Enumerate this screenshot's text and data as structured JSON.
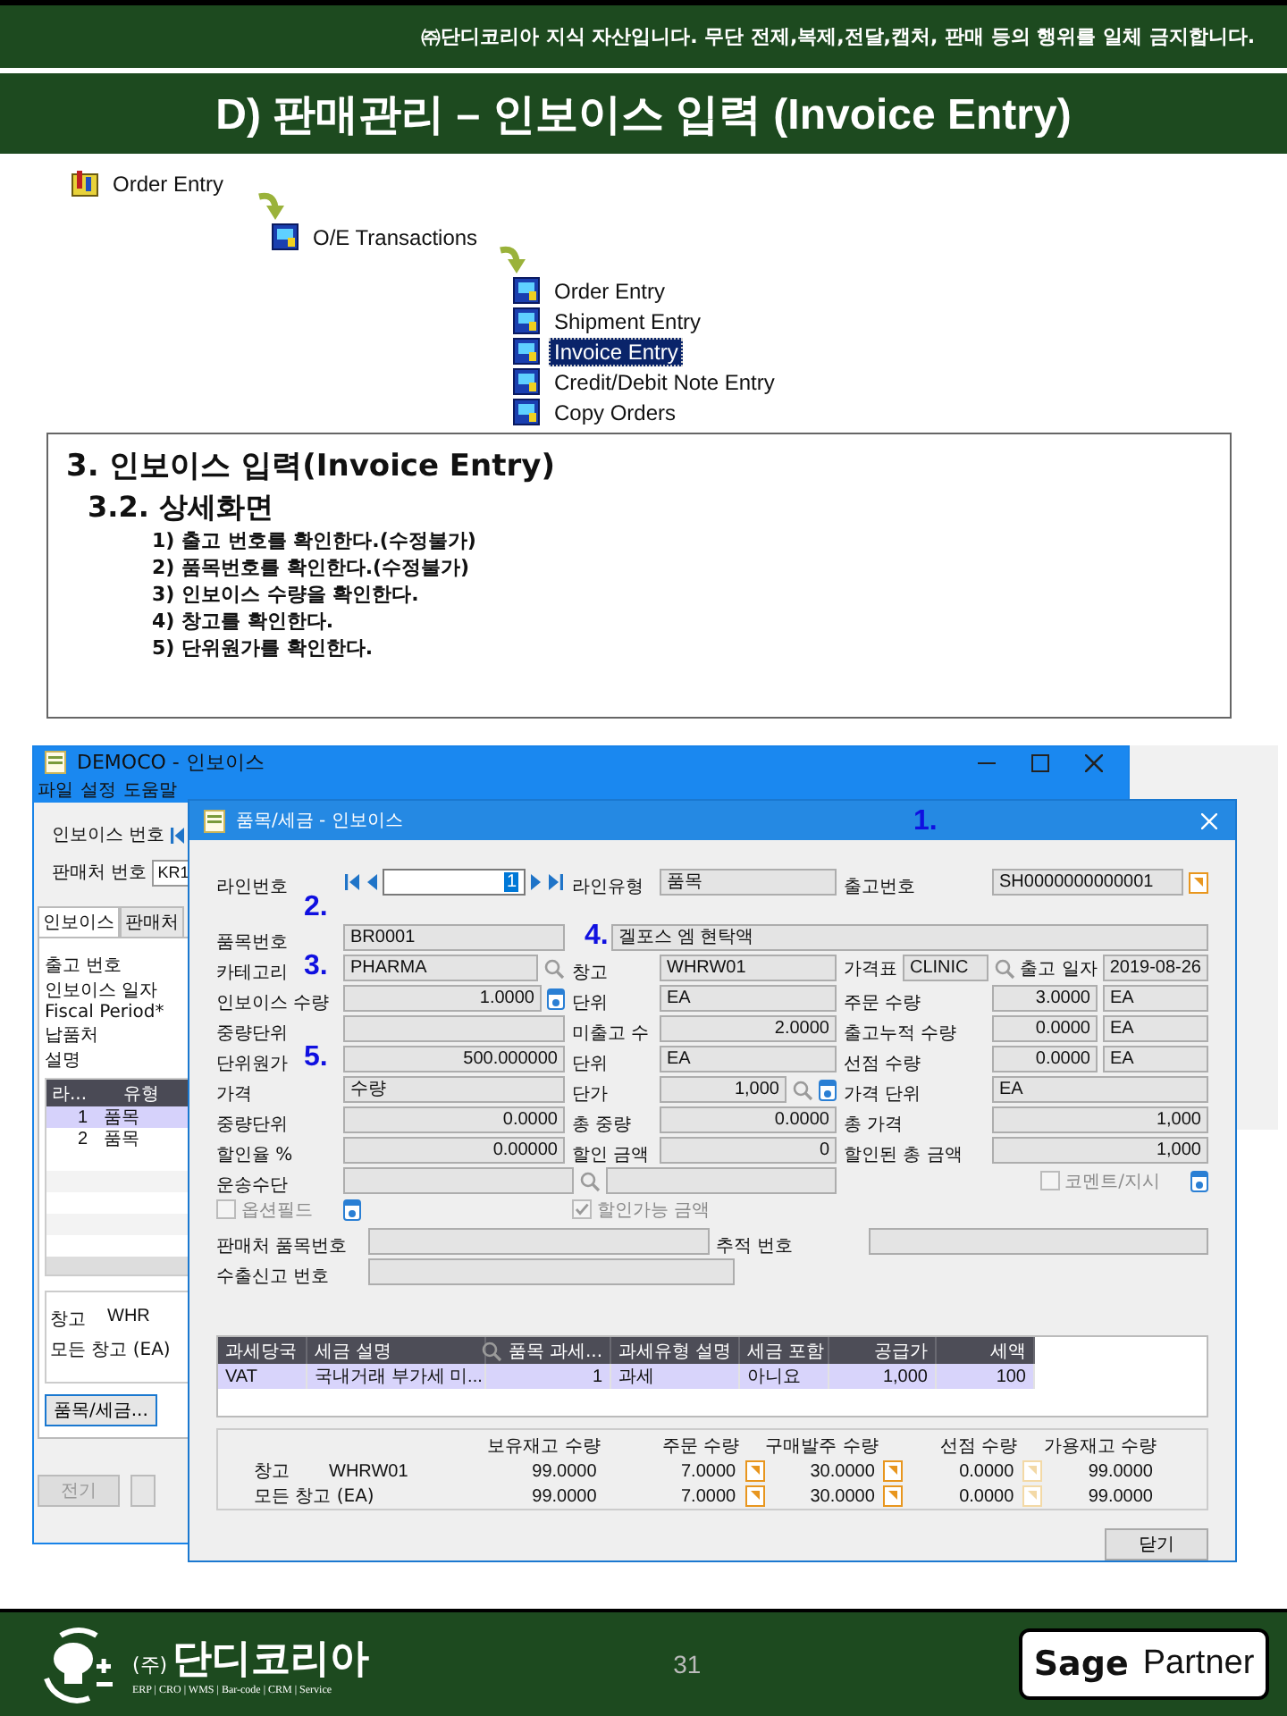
{
  "notice": "㈜단디코리아 지식 자산입니다. 무단 전제,복제,전달,캡처,  판매 등의 행위를 일체 금지합니다.",
  "title": "D) 판매관리 – 인보이스 입력 (Invoice Entry)",
  "menu_path": [
    {
      "label": "Order Entry",
      "selected": false,
      "children": [
        {
          "label": "O/E Transactions",
          "selected": false,
          "children": [
            {
              "label": "Order Entry",
              "selected": false
            },
            {
              "label": "Shipment Entry",
              "selected": false
            },
            {
              "label": "Invoice Entry",
              "selected": true
            },
            {
              "label": "Credit/Debit Note Entry",
              "selected": false
            },
            {
              "label": "Copy Orders",
              "selected": false
            }
          ]
        }
      ]
    }
  ],
  "instructions": {
    "heading": "3. 인보이스 입력(Invoice Entry)",
    "subheading": "3.2. 상세화면",
    "steps": [
      "1) 출고 번호를 확인한다.(수정불가)",
      "2) 품목번호를 확인한다.(수정불가)",
      "3) 인보이스 수량을 확인한다.",
      "4) 창고를 확인한다.",
      "5) 단위원가를 확인한다."
    ]
  },
  "main_window": {
    "title": "DEMOCO - 인보이스",
    "menu": [
      "파일",
      "설정",
      "도움말"
    ],
    "invoice_number_label": "인보이스 번호",
    "customer_label": "판매처 번호",
    "customer_value": "KR1",
    "tabs": [
      {
        "label": "인보이스",
        "selected": true
      },
      {
        "label": "판매처",
        "selected": false
      }
    ],
    "labels": [
      "출고 번호",
      "인보이스 일자",
      "Fiscal Period*",
      "납품처",
      "설명"
    ],
    "table": {
      "columns": [
        "라...",
        "유형"
      ],
      "rows": [
        {
          "cells": [
            "1",
            "품목"
          ],
          "selected": true
        },
        {
          "cells": [
            "2",
            "품목"
          ],
          "selected": false
        }
      ]
    },
    "stock_rows": [
      {
        "label": "창고",
        "value": "WHR"
      },
      {
        "label": "모든 창고 (EA)"
      }
    ],
    "item_tax_button": "품목/세금...",
    "post_button": {
      "label": "전기",
      "disabled": true
    }
  },
  "dialog": {
    "title": "품목/세금 - 인보이스",
    "annotations": [
      "1.",
      "2.",
      "3.",
      "4.",
      "5."
    ],
    "rows": [
      {
        "kind": "three",
        "groups": [
          [
            {
              "kind": "label",
              "text": "라인번호"
            },
            {
              "kind": "nav",
              "value": "1"
            }
          ],
          [
            {
              "kind": "label",
              "text": "라인유형"
            },
            {
              "kind": "field",
              "value": "품목"
            }
          ],
          [
            {
              "kind": "label",
              "text": "출고번호"
            },
            {
              "kind": "field",
              "value": "SH0000000000001"
            },
            {
              "kind": "doc"
            }
          ]
        ]
      },
      {
        "kind": "wide-right",
        "groups": [
          [
            {
              "kind": "label",
              "text": "품목번호"
            },
            {
              "kind": "field",
              "value": "BR0001"
            }
          ],
          [
            {
              "kind": "field",
              "value": "겔포스 엠 현탁액"
            }
          ]
        ]
      },
      {
        "kind": "three",
        "groups": [
          [
            {
              "kind": "label",
              "text": "카테고리"
            },
            {
              "kind": "field",
              "value": "PHARMA"
            },
            {
              "kind": "search"
            }
          ],
          [
            {
              "kind": "label",
              "text": "창고"
            },
            {
              "kind": "field",
              "value": "WHRW01"
            }
          ],
          [
            {
              "kind": "label",
              "text": "가격표"
            },
            {
              "kind": "field",
              "value": "CLINIC"
            },
            {
              "kind": "search"
            },
            {
              "kind": "label",
              "text": "출고 일자"
            },
            {
              "kind": "field",
              "value": "2019-08-26"
            }
          ]
        ]
      },
      {
        "kind": "three",
        "groups": [
          [
            {
              "kind": "label",
              "text": "인보이스 수량"
            },
            {
              "kind": "number",
              "value": "1.0000"
            },
            {
              "kind": "info"
            }
          ],
          [
            {
              "kind": "label",
              "text": "단위"
            },
            {
              "kind": "field",
              "value": "EA"
            }
          ],
          [
            {
              "kind": "label",
              "text": "주문 수량"
            },
            {
              "kind": "number",
              "value": "3.0000"
            },
            {
              "kind": "field",
              "value": "EA"
            }
          ]
        ]
      },
      {
        "kind": "three",
        "groups": [
          [
            {
              "kind": "label",
              "text": "중량단위"
            },
            {
              "kind": "field"
            }
          ],
          [
            {
              "kind": "label",
              "text": "미출고 수"
            },
            {
              "kind": "number",
              "value": "2.0000"
            }
          ],
          [
            {
              "kind": "label",
              "text": "출고누적 수량"
            },
            {
              "kind": "number",
              "value": "0.0000"
            },
            {
              "kind": "field",
              "value": "EA"
            }
          ]
        ]
      },
      {
        "kind": "three",
        "groups": [
          [
            {
              "kind": "label",
              "text": "단위원가"
            },
            {
              "kind": "number",
              "value": "500.000000"
            }
          ],
          [
            {
              "kind": "label",
              "text": "단위"
            },
            {
              "kind": "field",
              "value": "EA"
            }
          ],
          [
            {
              "kind": "label",
              "text": "선점 수량"
            },
            {
              "kind": "number",
              "value": "0.0000"
            },
            {
              "kind": "field",
              "value": "EA"
            }
          ]
        ]
      },
      {
        "kind": "three",
        "groups": [
          [
            {
              "kind": "label",
              "text": "가격"
            },
            {
              "kind": "field",
              "value": "수량"
            }
          ],
          [
            {
              "kind": "label",
              "text": "단가"
            },
            {
              "kind": "number",
              "value": "1,000"
            },
            {
              "kind": "search"
            },
            {
              "kind": "info"
            }
          ],
          [
            {
              "kind": "label",
              "text": "가격 단위"
            },
            {
              "kind": "field",
              "value": "EA"
            }
          ]
        ]
      },
      {
        "kind": "three",
        "groups": [
          [
            {
              "kind": "label",
              "text": "중량단위"
            },
            {
              "kind": "number",
              "value": "0.0000"
            }
          ],
          [
            {
              "kind": "label",
              "text": "총 중량"
            },
            {
              "kind": "number",
              "value": "0.0000"
            }
          ],
          [
            {
              "kind": "label",
              "text": "총 가격"
            },
            {
              "kind": "number",
              "value": "1,000"
            }
          ]
        ]
      },
      {
        "kind": "three",
        "groups": [
          [
            {
              "kind": "label",
              "text": "할인율 %"
            },
            {
              "kind": "number",
              "value": "0.00000"
            }
          ],
          [
            {
              "kind": "label",
              "text": "할인 금액"
            },
            {
              "kind": "number",
              "value": "0"
            }
          ],
          [
            {
              "kind": "label",
              "text": "할인된 총 금액"
            },
            {
              "kind": "number",
              "value": "1,000"
            }
          ]
        ]
      },
      {
        "kind": "wide-left",
        "groups": [
          [
            {
              "kind": "label",
              "text": "운송수단"
            },
            {
              "kind": "field"
            },
            {
              "kind": "search"
            },
            {
              "kind": "field"
            }
          ],
          [
            {
              "kind": "checkbox",
              "text": "코멘트/지시",
              "checked": false,
              "disabled": true
            },
            {
              "kind": "info"
            }
          ]
        ]
      },
      {
        "kind": "three",
        "groups": [
          [
            {
              "kind": "checkbox",
              "text": "옵션필드",
              "checked": false,
              "disabled": true
            },
            {
              "kind": "info"
            }
          ],
          [
            {
              "kind": "checkbox",
              "text": "할인가능 금액",
              "checked": true,
              "disabled": true
            }
          ]
        ]
      },
      {
        "kind": "two",
        "groups": [
          [
            {
              "kind": "label",
              "text": "판매처 품목번호"
            },
            {
              "kind": "field"
            }
          ],
          [
            {
              "kind": "label",
              "text": "추적 번호"
            },
            {
              "kind": "field"
            }
          ]
        ]
      },
      {
        "kind": "single",
        "groups": [
          [
            {
              "kind": "label",
              "text": "수출신고 번호"
            },
            {
              "kind": "field"
            }
          ]
        ]
      }
    ],
    "tax_table": {
      "columns": [
        {
          "label": "과세당국",
          "kind": "text"
        },
        {
          "label": "세금 설명",
          "kind": "text"
        },
        {
          "label": "품목 과세...",
          "kind": "number",
          "searchable": true
        },
        {
          "label": "과세유형 설명",
          "kind": "text"
        },
        {
          "label": "세금 포함",
          "kind": "text"
        },
        {
          "label": "공급가",
          "kind": "number"
        },
        {
          "label": "세액",
          "kind": "number"
        }
      ],
      "rows": [
        {
          "cells": [
            "VAT",
            "국내거래 부가세 미...",
            "1",
            "과세",
            "아니요",
            "1,000",
            "100"
          ],
          "selected": true
        }
      ]
    },
    "summary": {
      "columns": [
        "보유재고 수량",
        "주문 수량",
        "구매발주 수량",
        "선점 수량",
        "가용재고 수량"
      ],
      "rows": [
        {
          "label": "창고",
          "code": "WHRW01",
          "cells": [
            {
              "value": "99.0000"
            },
            {
              "value": "7.0000",
              "drilldown": true,
              "disabled": false
            },
            {
              "value": "30.0000",
              "drilldown": true,
              "disabled": false
            },
            {
              "value": "0.0000",
              "drilldown": true,
              "disabled": true
            },
            {
              "value": "99.0000"
            }
          ]
        },
        {
          "label": "모든 창고 (EA)",
          "cells": [
            {
              "value": "99.0000"
            },
            {
              "value": "7.0000",
              "drilldown": true,
              "disabled": false
            },
            {
              "value": "30.0000",
              "drilldown": true,
              "disabled": false
            },
            {
              "value": "0.0000",
              "drilldown": true,
              "disabled": true
            },
            {
              "value": "99.0000"
            }
          ]
        }
      ]
    },
    "close_button": "닫기"
  },
  "footer": {
    "company_prefix": "(주)",
    "company_name": "단디코리아",
    "tagline": "ERP | CRO | WMS | Bar-code | CRM | Service",
    "page": "31",
    "partner_badge": {
      "brand": "Sage",
      "label": "Partner"
    }
  }
}
